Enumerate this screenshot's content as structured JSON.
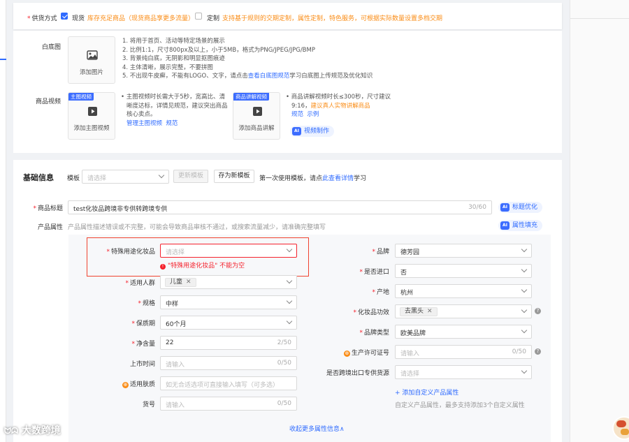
{
  "supply": {
    "label": "供货方式",
    "spot_label": "现货",
    "spot_desc": "库存充足商品（现货商品享更多流量）",
    "custom_label": "定制",
    "custom_desc": "支持基于规则的交期定制，属性定制，特色服务，可根据实际数量设置多档交期"
  },
  "white_bg": {
    "label": "白底图",
    "upload_label": "添加图片",
    "rules": [
      "1. 将用于首页、活动等特定场景的展示",
      "2. 比例1:1，尺寸800px及以上，小于5MB，格式为PNG/JPEG/JPG/BMP",
      "3. 背景纯白底，无阴影和明显抠图痕迹",
      "4. 主体清晰，展示完整，不要拼图"
    ],
    "rule5_prefix": "5. 不出现牛皮癣，不能有LOGO、文字，请点击",
    "rule5_link": "查看白底图规范",
    "rule5_suffix": "学习白底图上传规范及优化知识"
  },
  "video": {
    "label": "商品视频",
    "main_tag": "主图视频",
    "main_upload": "添加主图视频",
    "main_desc": [
      "主图视频时长需大于5秒，宽高比、清",
      "晰度达标，详情见规范，建议突出商品",
      "核心卖点。"
    ],
    "main_manage_link": "管理主图视频",
    "main_spec_link": "规范",
    "explain_tag": "商品讲解视频",
    "explain_upload": "添加商品讲解",
    "explain_desc1": "商品讲解视频时长≤300秒，尺寸建议",
    "explain_desc2_prefix": "9:16，",
    "explain_desc2_orange": "建议真人实物讲解商品",
    "explain_spec_link": "规范",
    "explain_example_link": "示例",
    "ai_video": "视频制作"
  },
  "basic": {
    "title": "基础信息",
    "template_label": "模板",
    "template_placeholder": "请选择",
    "update_button": "更新模板",
    "save_new_button": "存为新模板",
    "first_time_text": "第一次使用模板，请点",
    "first_time_link": "此查看详情",
    "first_time_suffix": "学习"
  },
  "title_field": {
    "label": "商品标题",
    "value": "test化妆品跨境非专供转跨境专供",
    "count": "30/60",
    "ai_button": "标题优化"
  },
  "attrs": {
    "label": "产品属性",
    "hint": "产品属性描述错误或不完整，可能会导致商品审核不通过，或搜索流量减少，请准确完整填写",
    "ai_button": "属性填充"
  },
  "left_fields": {
    "special_use": {
      "label": "特殊用途化妆品",
      "placeholder": "请选择",
      "error": "\"特殊用途化妆品\" 不能为空"
    },
    "crowd": {
      "label": "适用人群",
      "tag": "儿童"
    },
    "spec": {
      "label": "规格",
      "value": "中样"
    },
    "shelf_life": {
      "label": "保质期",
      "value": "60个月"
    },
    "net_content": {
      "label": "净含量",
      "value": "22",
      "count": "2/50"
    },
    "launch_time": {
      "label": "上市时间",
      "placeholder": "请输入",
      "count": "0/50"
    },
    "skin_type": {
      "label": "适用肤质",
      "placeholder": "如无合适选项可直接输入填写（可多选）"
    },
    "item_no": {
      "label": "货号",
      "placeholder": "请输入",
      "count": "0/50"
    }
  },
  "right_fields": {
    "brand": {
      "label": "品牌",
      "value": "德芳园"
    },
    "imported": {
      "label": "是否进口",
      "value": "否"
    },
    "origin": {
      "label": "产地",
      "value": "杭州"
    },
    "efficacy": {
      "label": "化妆品功效",
      "tag": "去黑头"
    },
    "brand_type": {
      "label": "品牌类型",
      "value": "欧美品牌"
    },
    "license": {
      "label": "生产许可证号",
      "placeholder": "请输入",
      "count": "0/50"
    },
    "cross_border": {
      "label": "是否跨境出口专供货源",
      "placeholder": "请选择"
    },
    "add_custom": "+ 添加自定义产品属性",
    "custom_hint": "自定义产品属性，最多支持添加3个自定义属性"
  },
  "collapse_link": "收起更多属性信息∧",
  "watermark": "大数跨境",
  "colors": {
    "accent": "#2f6bff",
    "error": "#f5222d",
    "warn": "#fa8c16"
  }
}
